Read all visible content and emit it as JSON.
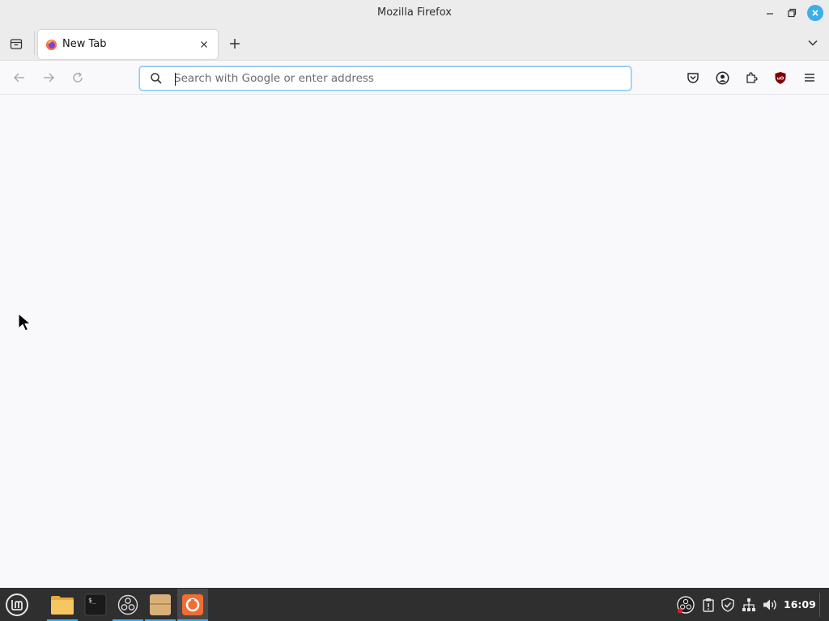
{
  "window": {
    "title": "Mozilla Firefox",
    "accent": "#3daee9"
  },
  "tabs": [
    {
      "label": "New Tab",
      "active": true,
      "icon": "firefox-icon"
    }
  ],
  "navbar": {
    "search_placeholder": "Search with Google or enter address",
    "search_value": ""
  },
  "toolbar_icons": [
    "pocket-icon",
    "account-icon",
    "extensions-icon",
    "ublock-origin-icon",
    "hamburger-menu-icon"
  ],
  "taskbar": {
    "apps": [
      {
        "name": "files",
        "icon": "folder-icon",
        "running": true
      },
      {
        "name": "terminal",
        "icon": "terminal-icon",
        "running": false
      },
      {
        "name": "obs",
        "icon": "obs-icon",
        "running": true
      },
      {
        "name": "archive",
        "icon": "archive-icon",
        "running": true
      },
      {
        "name": "firefox",
        "icon": "firefox-icon",
        "running": true,
        "active": true
      }
    ],
    "tray_icons": [
      "obs-tray-icon",
      "clipboard-icon",
      "shield-icon",
      "network-icon",
      "volume-icon"
    ],
    "clock": "16:09"
  },
  "colors": {
    "ublock_red": "#800000",
    "taskbar_bg": "#2f2f2f",
    "urlbar_focus": "#8ec5f0"
  }
}
